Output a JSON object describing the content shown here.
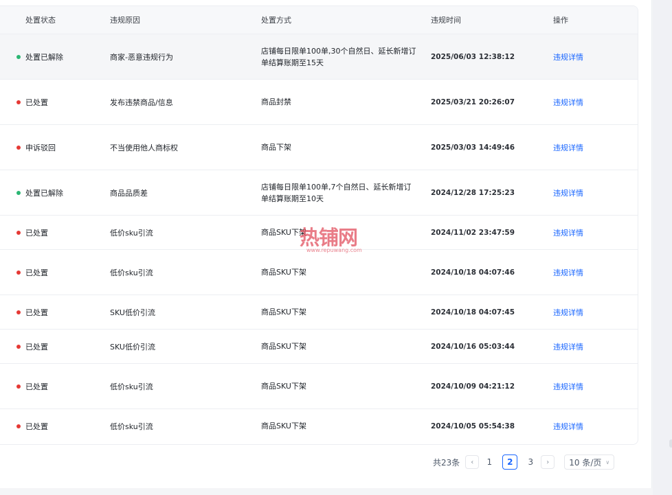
{
  "table": {
    "headers": [
      "处置状态",
      "违规原因",
      "处置方式",
      "违规时间",
      "操作"
    ],
    "rows": [
      {
        "status": "处置已解除",
        "status_color": "#2bb673",
        "reason": "商家-恶意违规行为",
        "method": "店铺每日限单100单,30个自然日、延长新增订单结算账期至15天",
        "time": "2025/06/03 12:38:12",
        "action": "违规详情"
      },
      {
        "status": "已处置",
        "status_color": "#e53935",
        "reason": "发布违禁商品/信息",
        "method": "商品封禁",
        "time": "2025/03/21 20:26:07",
        "action": "违规详情"
      },
      {
        "status": "申诉驳回",
        "status_color": "#e53935",
        "reason": "不当使用他人商标权",
        "method": "商品下架",
        "time": "2025/03/03 14:49:46",
        "action": "违规详情"
      },
      {
        "status": "处置已解除",
        "status_color": "#2bb673",
        "reason": "商品品质差",
        "method": "店铺每日限单100单,7个自然日、延长新增订单结算账期至10天",
        "time": "2024/12/28 17:25:23",
        "action": "违规详情"
      },
      {
        "status": "已处置",
        "status_color": "#e53935",
        "reason": "低价sku引流",
        "method": "商品SKU下架",
        "time": "2024/11/02 23:47:59",
        "action": "违规详情"
      },
      {
        "status": "已处置",
        "status_color": "#e53935",
        "reason": "低价sku引流",
        "method": "商品SKU下架",
        "time": "2024/10/18 04:07:46",
        "action": "违规详情"
      },
      {
        "status": "已处置",
        "status_color": "#e53935",
        "reason": "SKU低价引流",
        "method": "商品SKU下架",
        "time": "2024/10/18 04:07:45",
        "action": "违规详情"
      },
      {
        "status": "已处置",
        "status_color": "#e53935",
        "reason": "SKU低价引流",
        "method": "商品SKU下架",
        "time": "2024/10/16 05:03:44",
        "action": "违规详情"
      },
      {
        "status": "已处置",
        "status_color": "#e53935",
        "reason": "低价sku引流",
        "method": "商品SKU下架",
        "time": "2024/10/09 04:21:12",
        "action": "违规详情"
      },
      {
        "status": "已处置",
        "status_color": "#e53935",
        "reason": "低价sku引流",
        "method": "商品SKU下架",
        "time": "2024/10/05 05:54:38",
        "action": "违规详情"
      }
    ]
  },
  "pagination": {
    "total_label": "共23条",
    "prev_icon": "chevron-left-icon",
    "next_icon": "chevron-right-icon",
    "pages": [
      "1",
      "2",
      "3"
    ],
    "current_page": "2",
    "page_size_label": "10 条/页"
  },
  "watermark": {
    "text": "热铺网",
    "url": "www.repuwang.com"
  },
  "colors": {
    "accent": "#1966ff",
    "resolved": "#2bb673",
    "penalized": "#e53935"
  }
}
